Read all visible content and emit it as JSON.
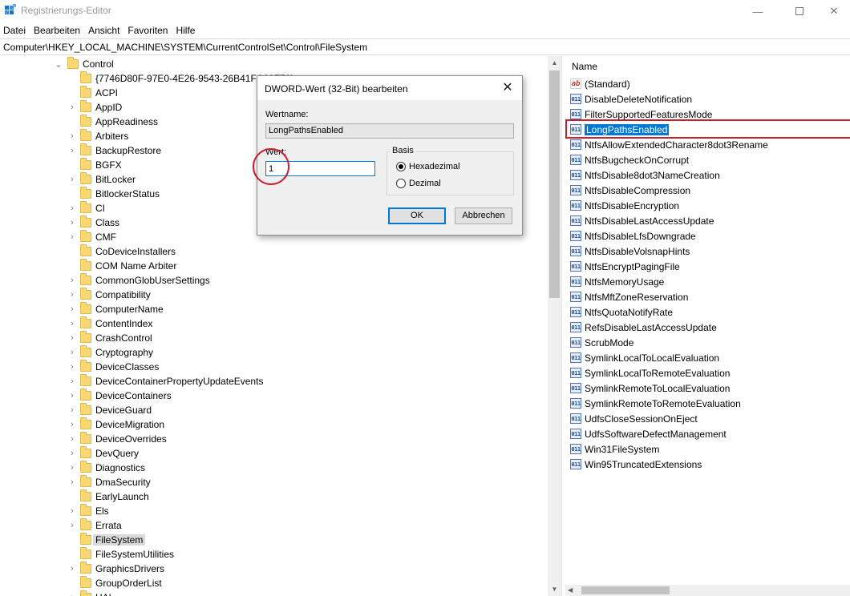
{
  "window": {
    "title": "Registrierungs-Editor",
    "minimize_glyph": "—",
    "close_glyph": "✕"
  },
  "menu": [
    "Datei",
    "Bearbeiten",
    "Ansicht",
    "Favoriten",
    "Hilfe"
  ],
  "address": "Computer\\HKEY_LOCAL_MACHINE\\SYSTEM\\CurrentControlSet\\Control\\FileSystem",
  "tree": {
    "root": {
      "label": "Control",
      "expanded": true
    },
    "children": [
      {
        "label": "{7746D80F-97E0-4E26-9543-26B41FC22F79}",
        "expandable": false
      },
      {
        "label": "ACPI",
        "expandable": false
      },
      {
        "label": "AppID",
        "expandable": true
      },
      {
        "label": "AppReadiness",
        "expandable": false
      },
      {
        "label": "Arbiters",
        "expandable": true
      },
      {
        "label": "BackupRestore",
        "expandable": true
      },
      {
        "label": "BGFX",
        "expandable": false
      },
      {
        "label": "BitLocker",
        "expandable": true
      },
      {
        "label": "BitlockerStatus",
        "expandable": false
      },
      {
        "label": "CI",
        "expandable": true
      },
      {
        "label": "Class",
        "expandable": true
      },
      {
        "label": "CMF",
        "expandable": true
      },
      {
        "label": "CoDeviceInstallers",
        "expandable": false
      },
      {
        "label": "COM Name Arbiter",
        "expandable": false
      },
      {
        "label": "CommonGlobUserSettings",
        "expandable": true
      },
      {
        "label": "Compatibility",
        "expandable": true
      },
      {
        "label": "ComputerName",
        "expandable": true
      },
      {
        "label": "ContentIndex",
        "expandable": true
      },
      {
        "label": "CrashControl",
        "expandable": true
      },
      {
        "label": "Cryptography",
        "expandable": true
      },
      {
        "label": "DeviceClasses",
        "expandable": true
      },
      {
        "label": "DeviceContainerPropertyUpdateEvents",
        "expandable": true
      },
      {
        "label": "DeviceContainers",
        "expandable": true
      },
      {
        "label": "DeviceGuard",
        "expandable": true
      },
      {
        "label": "DeviceMigration",
        "expandable": true
      },
      {
        "label": "DeviceOverrides",
        "expandable": true
      },
      {
        "label": "DevQuery",
        "expandable": true
      },
      {
        "label": "Diagnostics",
        "expandable": true
      },
      {
        "label": "DmaSecurity",
        "expandable": true
      },
      {
        "label": "EarlyLaunch",
        "expandable": false
      },
      {
        "label": "Els",
        "expandable": true
      },
      {
        "label": "Errata",
        "expandable": true
      },
      {
        "label": "FileSystem",
        "expandable": false,
        "selected": true
      },
      {
        "label": "FileSystemUtilities",
        "expandable": false
      },
      {
        "label": "GraphicsDrivers",
        "expandable": true
      },
      {
        "label": "GroupOrderList",
        "expandable": false
      },
      {
        "label": "HAL",
        "expandable": true
      }
    ]
  },
  "values_pane": {
    "column_header": "Name",
    "items": [
      {
        "name": "(Standard)",
        "type": "sz"
      },
      {
        "name": "DisableDeleteNotification",
        "type": "dword"
      },
      {
        "name": "FilterSupportedFeaturesMode",
        "type": "dword"
      },
      {
        "name": "LongPathsEnabled",
        "type": "dword",
        "selected": true
      },
      {
        "name": "NtfsAllowExtendedCharacter8dot3Rename",
        "type": "dword"
      },
      {
        "name": "NtfsBugcheckOnCorrupt",
        "type": "dword"
      },
      {
        "name": "NtfsDisable8dot3NameCreation",
        "type": "dword"
      },
      {
        "name": "NtfsDisableCompression",
        "type": "dword"
      },
      {
        "name": "NtfsDisableEncryption",
        "type": "dword"
      },
      {
        "name": "NtfsDisableLastAccessUpdate",
        "type": "dword"
      },
      {
        "name": "NtfsDisableLfsDowngrade",
        "type": "dword"
      },
      {
        "name": "NtfsDisableVolsnapHints",
        "type": "dword"
      },
      {
        "name": "NtfsEncryptPagingFile",
        "type": "dword"
      },
      {
        "name": "NtfsMemoryUsage",
        "type": "dword"
      },
      {
        "name": "NtfsMftZoneReservation",
        "type": "dword"
      },
      {
        "name": "NtfsQuotaNotifyRate",
        "type": "dword"
      },
      {
        "name": "RefsDisableLastAccessUpdate",
        "type": "dword"
      },
      {
        "name": "ScrubMode",
        "type": "dword"
      },
      {
        "name": "SymlinkLocalToLocalEvaluation",
        "type": "dword"
      },
      {
        "name": "SymlinkLocalToRemoteEvaluation",
        "type": "dword"
      },
      {
        "name": "SymlinkRemoteToLocalEvaluation",
        "type": "dword"
      },
      {
        "name": "SymlinkRemoteToRemoteEvaluation",
        "type": "dword"
      },
      {
        "name": "UdfsCloseSessionOnEject",
        "type": "dword"
      },
      {
        "name": "UdfsSoftwareDefectManagement",
        "type": "dword"
      },
      {
        "name": "Win31FileSystem",
        "type": "dword"
      },
      {
        "name": "Win95TruncatedExtensions",
        "type": "dword"
      }
    ]
  },
  "dialog": {
    "title": "DWORD-Wert (32-Bit) bearbeiten",
    "name_label": "Wertname:",
    "name_value": "LongPathsEnabled",
    "value_label": "Wert:",
    "value": "1",
    "basis_label": "Basis",
    "radio_hex": "Hexadezimal",
    "radio_dec": "Dezimal",
    "selected_basis": "hex",
    "ok": "OK",
    "cancel": "Abbrechen"
  },
  "icons": {
    "string_value": "ab",
    "dword_value": "011"
  },
  "colors": {
    "selection": "#0078d7",
    "annotation": "#c8202f",
    "folder": "#f8d775"
  }
}
